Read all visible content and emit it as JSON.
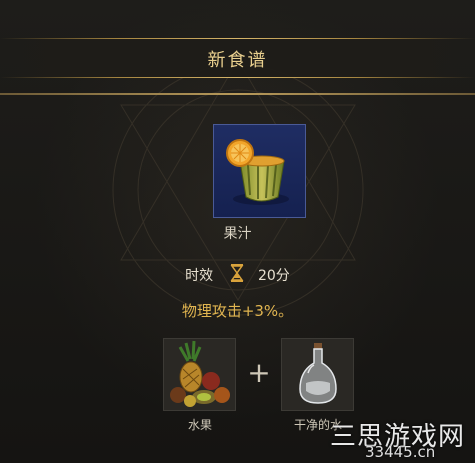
{
  "header": {
    "title": "新食谱"
  },
  "result": {
    "name": "果汁",
    "icon": "juice-cup-icon",
    "bg_color": "#1f2d63"
  },
  "duration": {
    "label": "时效",
    "icon": "hourglass-icon",
    "value": "20分"
  },
  "effect": {
    "text": "物理攻击+3%。",
    "color": "#e1b550"
  },
  "ingredients": [
    {
      "name": "水果",
      "icon": "fruit-pile-icon"
    },
    {
      "name": "干净的水",
      "icon": "water-bottle-icon"
    }
  ],
  "plus_symbol": "+",
  "watermark": {
    "text": "三思游戏网",
    "url": "33445.cn"
  },
  "colors": {
    "accent": "#e9cf8e",
    "gold_line": "#b89a5a"
  }
}
